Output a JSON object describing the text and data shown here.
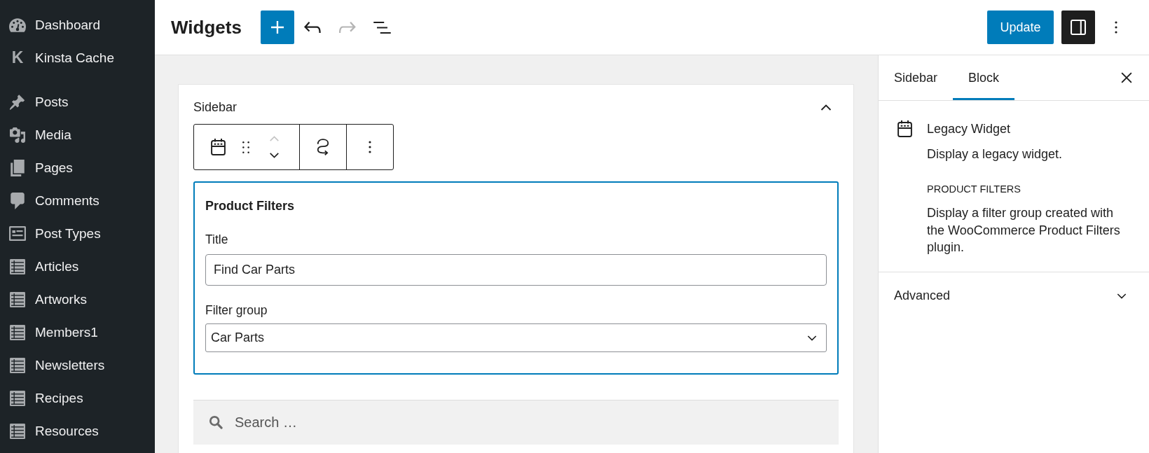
{
  "admin_menu": {
    "groups": [
      {
        "items": [
          {
            "label": "Dashboard",
            "kind": "dashboard"
          },
          {
            "label": "Kinsta Cache",
            "kind": "glyph",
            "glyph": "K"
          }
        ]
      },
      {
        "items": [
          {
            "label": "Posts",
            "kind": "posts"
          },
          {
            "label": "Media",
            "kind": "media"
          },
          {
            "label": "Pages",
            "kind": "pages"
          },
          {
            "label": "Comments",
            "kind": "comments"
          },
          {
            "label": "Post Types",
            "kind": "post-types"
          },
          {
            "label": "Articles",
            "kind": "custom"
          },
          {
            "label": "Artworks",
            "kind": "custom"
          },
          {
            "label": "Members1",
            "kind": "custom"
          },
          {
            "label": "Newsletters",
            "kind": "custom"
          },
          {
            "label": "Recipes",
            "kind": "custom"
          },
          {
            "label": "Resources",
            "kind": "custom"
          }
        ]
      }
    ]
  },
  "header": {
    "title": "Widgets",
    "tools": [
      {
        "kind": "inserter",
        "disabled": false
      },
      {
        "kind": "undo",
        "disabled": false
      },
      {
        "kind": "redo",
        "disabled": true
      },
      {
        "kind": "list-view",
        "disabled": false
      }
    ],
    "update_button": "Update",
    "settings_toggle": {
      "on": true
    }
  },
  "widget_area": {
    "title": "Sidebar",
    "expanded": true,
    "block_toolbar": {
      "move_up_disabled": true,
      "move_down_disabled": false
    },
    "block": {
      "title": "Product Filters",
      "selected": true,
      "fields": [
        {
          "kind": "text",
          "label": "Title",
          "value": "Find Car Parts"
        },
        {
          "kind": "select",
          "label": "Filter group",
          "value": "Car Parts"
        }
      ]
    },
    "search": {
      "placeholder": "Search …"
    }
  },
  "inspector": {
    "tabs": [
      {
        "label": "Sidebar",
        "selected": false
      },
      {
        "label": "Block",
        "selected": true
      }
    ],
    "block_card": {
      "title": "Legacy Widget",
      "description": "Display a legacy widget."
    },
    "widget_info": {
      "heading": "PRODUCT FILTERS",
      "description": "Display a filter group created with the WooCommerce Product Filters plugin."
    },
    "panels": [
      {
        "title": "Advanced",
        "expanded": false
      }
    ]
  }
}
